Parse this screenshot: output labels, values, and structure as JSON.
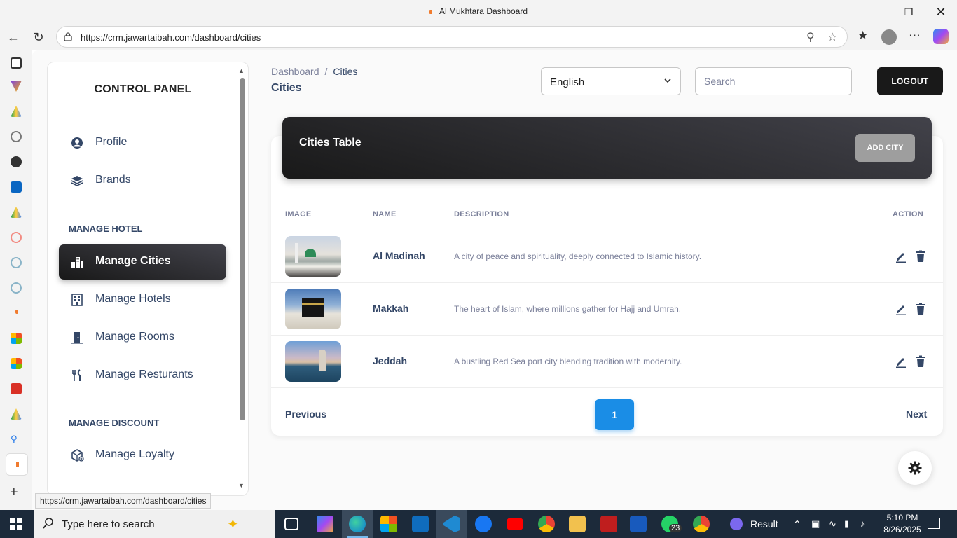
{
  "browser": {
    "window_title": "Al Mukhtara Dashboard",
    "url": "https://crm.jawartaibah.com/dashboard/cities",
    "status_url": "https://crm.jawartaibah.com/dashboard/cities"
  },
  "sidebar": {
    "title": "CONTROL PANEL",
    "items": [
      {
        "label": "Profile",
        "icon": "user-circle-icon"
      },
      {
        "label": "Brands",
        "icon": "layers-icon"
      }
    ],
    "section_hotel": "MANAGE HOTEL",
    "hotel_items": [
      {
        "label": "Manage Cities",
        "icon": "city-icon",
        "active": true
      },
      {
        "label": "Manage Hotels",
        "icon": "hotel-icon"
      },
      {
        "label": "Manage Rooms",
        "icon": "door-icon"
      },
      {
        "label": "Manage Resturants",
        "icon": "utensils-icon"
      }
    ],
    "section_discount": "MANAGE DISCOUNT",
    "discount_items": [
      {
        "label": "Manage Loyalty",
        "icon": "loyalty-box-icon"
      }
    ]
  },
  "header": {
    "breadcrumb_root": "Dashboard",
    "breadcrumb_sep": "/",
    "breadcrumb_current": "Cities",
    "page_title": "Cities",
    "language": "English",
    "search_placeholder": "Search",
    "logout_label": "LOGOUT"
  },
  "table": {
    "title": "Cities Table",
    "add_label": "ADD CITY",
    "columns": [
      "IMAGE",
      "NAME",
      "DESCRIPTION",
      "ACTION"
    ],
    "rows": [
      {
        "name": "Al Madinah",
        "description": "A city of peace and spirituality, deeply connected to Islamic history."
      },
      {
        "name": "Makkah",
        "description": "The heart of Islam, where millions gather for Hajj and Umrah."
      },
      {
        "name": "Jeddah",
        "description": "A bustling Red Sea port city blending tradition with modernity."
      }
    ]
  },
  "pagination": {
    "previous": "Previous",
    "current_page": "1",
    "next": "Next"
  },
  "taskbar": {
    "search_text": "Type here to search",
    "result_label": "Result",
    "badge_count": "23",
    "time": "5:10 PM",
    "date": "8/26/2025"
  },
  "colors": {
    "accent_dark": "#191919",
    "page_button": "#1a8de6",
    "add_button": "#9e9e9e"
  }
}
